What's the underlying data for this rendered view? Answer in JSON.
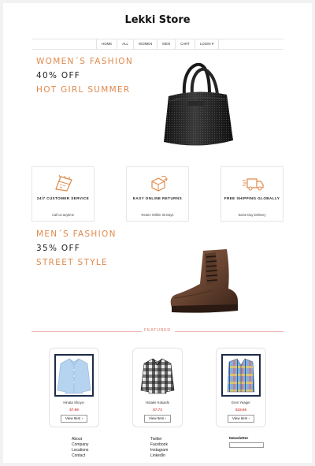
{
  "brand": "Lekki Store",
  "nav": [
    "HOME",
    "ALL",
    "WOMEN",
    "MEN",
    "CART",
    "LOGIN ▾"
  ],
  "promos": [
    {
      "line1": "WOMEN´S FASHION",
      "line2": "40% OFF",
      "line3": "HOT GIRL SUMMER"
    },
    {
      "line1": "MEN´S FASHION",
      "line2": "35% OFF",
      "line3": "STREET STYLE"
    }
  ],
  "features": [
    {
      "title": "24/7 CUSTOMER SERVICE",
      "sub": "Call us anytime",
      "icon": "calendar-icon"
    },
    {
      "title": "EASY ONLINE RETURNS",
      "sub": "Return Within 30 Days",
      "icon": "return-box-icon"
    },
    {
      "title": "FREE SHIPPING GLOBALLY",
      "sub": "Same Day Delivery",
      "icon": "delivery-truck-icon"
    }
  ],
  "featured_label": "FEATURED",
  "products": [
    {
      "name": "Hinata Shoyo-",
      "price": "$7.99",
      "button": "View Item ›",
      "image": "blue-shirt"
    },
    {
      "name": "Hotake Kokashi",
      "price": "$7.73",
      "button": "View Item ›",
      "image": "plaid-flannel-shirt"
    },
    {
      "name": "Eren Yeager",
      "price": "$19.66",
      "button": "View Item ›",
      "image": "plaid-dress-shirt"
    }
  ],
  "footer": {
    "col1": [
      "About",
      "Company",
      "Locations",
      "Contact"
    ],
    "col2": [
      "Twitter",
      "Facebook",
      "Instagram",
      "LinkedIn"
    ],
    "newsletter_label": "Newsletter",
    "newsletter_value": ""
  },
  "colors": {
    "accent": "#e08a4c",
    "featured": "#e07a6f",
    "price": "#d9534f",
    "card_border": "#1d2b4a"
  }
}
